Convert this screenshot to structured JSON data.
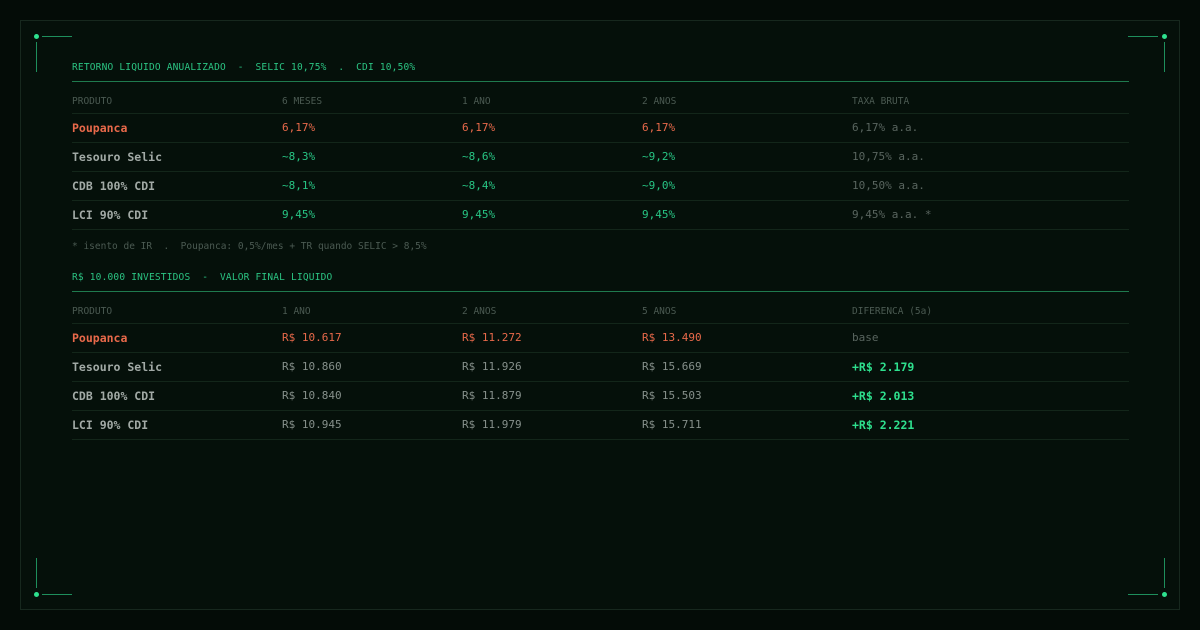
{
  "section1": {
    "title": "RETORNO LIQUIDO ANUALIZADO  -  SELIC 10,75%  .  CDI 10,50%",
    "headers": [
      "PRODUTO",
      "6 MESES",
      "1 ANO",
      "2 ANOS",
      "TAXA BRUTA"
    ],
    "rows": [
      {
        "product": "Poupanca",
        "m6": "6,17%",
        "y1": "6,17%",
        "y2": "6,17%",
        "rate": "6,17% a.a."
      },
      {
        "product": "Tesouro Selic",
        "m6": "~8,3%",
        "y1": "~8,6%",
        "y2": "~9,2%",
        "rate": "10,75% a.a."
      },
      {
        "product": "CDB 100% CDI",
        "m6": "~8,1%",
        "y1": "~8,4%",
        "y2": "~9,0%",
        "rate": "10,50% a.a."
      },
      {
        "product": "LCI 90% CDI",
        "m6": "9,45%",
        "y1": "9,45%",
        "y2": "9,45%",
        "rate": "9,45% a.a. *"
      }
    ],
    "footnote": "* isento de IR  .  Poupanca: 0,5%/mes + TR quando SELIC > 8,5%"
  },
  "section2": {
    "title": "R$ 10.000 INVESTIDOS  -  VALOR FINAL LIQUIDO",
    "headers": [
      "PRODUTO",
      "1 ANO",
      "2 ANOS",
      "5 ANOS",
      "DIFERENCA (5a)"
    ],
    "rows": [
      {
        "product": "Poupanca",
        "y1": "R$ 10.617",
        "y2": "R$ 11.272",
        "y5": "R$ 13.490",
        "diff": "base"
      },
      {
        "product": "Tesouro Selic",
        "y1": "R$ 10.860",
        "y2": "R$ 11.926",
        "y5": "R$ 15.669",
        "diff": "+R$ 2.179"
      },
      {
        "product": "CDB 100% CDI",
        "y1": "R$ 10.840",
        "y2": "R$ 11.879",
        "y5": "R$ 15.503",
        "diff": "+R$ 2.013"
      },
      {
        "product": "LCI 90% CDI",
        "y1": "R$ 10.945",
        "y2": "R$ 11.979",
        "y5": "R$ 15.711",
        "diff": "+R$ 2.221"
      }
    ]
  },
  "colors": {
    "accent": "#2bc483",
    "negative": "#e8694a",
    "positive": "#27c584",
    "background": "#05100a"
  }
}
